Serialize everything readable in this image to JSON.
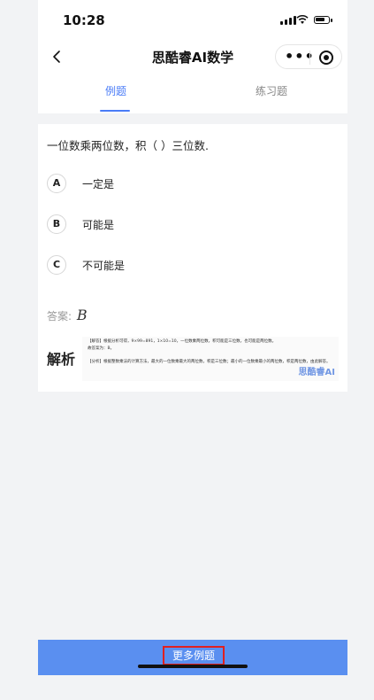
{
  "status": {
    "time": "10:28"
  },
  "nav": {
    "title": "思酷睿AI数学"
  },
  "tabs": [
    {
      "label": "例题",
      "active": true
    },
    {
      "label": "练习题",
      "active": false
    }
  ],
  "question": {
    "text": "一位数乘两位数，积（  ）三位数.",
    "options": [
      {
        "letter": "A",
        "text": "一定是"
      },
      {
        "letter": "B",
        "text": "可能是"
      },
      {
        "letter": "C",
        "text": "不可能是"
      }
    ],
    "answer_label": "答案:",
    "answer_value": "B"
  },
  "explanation": {
    "title": "解析",
    "lines": [
      "【解答】根据分析可得，9×99=891，1×10=10，一位数乘两位数，积可能是三位数，也可能是两位数。",
      "故答案为：B。",
      "【分析】根据整数乘法的计算方法，最大的一位数乘最大的两位数，积是三位数；最小的一位数乘最小的两位数，积是两位数，由此解答。"
    ],
    "watermark": "思酷睿AI"
  },
  "bottom": {
    "more_label": "更多例题"
  },
  "colors": {
    "accent": "#4a7cf7",
    "bottom_bar": "#5a8ff0",
    "highlight_border": "#e02020"
  }
}
